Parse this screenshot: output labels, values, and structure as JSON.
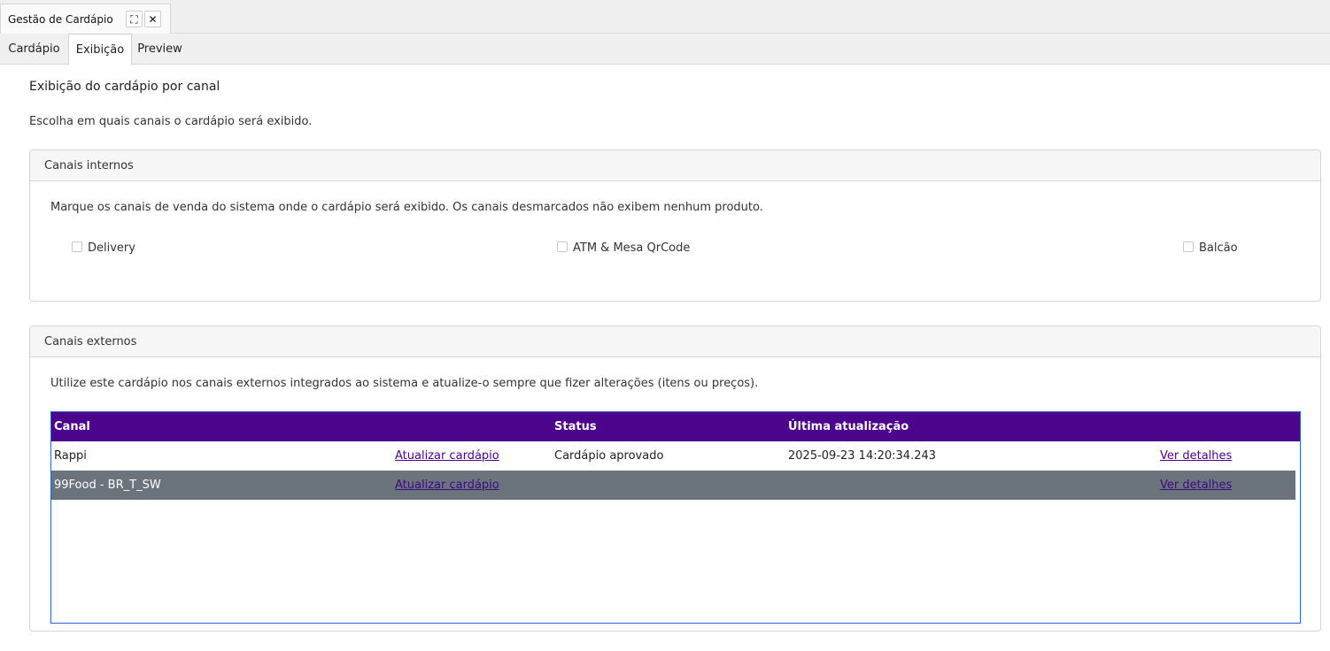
{
  "window_tab": {
    "title": "Gestão de Cardápio",
    "expand_glyph": "⛶",
    "close_glyph": "✕"
  },
  "subtabs": [
    {
      "label": "Cardápio",
      "active": false
    },
    {
      "label": "Exibição",
      "active": true
    },
    {
      "label": "Preview",
      "active": false
    }
  ],
  "page": {
    "title": "Exibição do cardápio por canal",
    "description": "Escolha em quais canais o cardápio será exibido."
  },
  "internal_channels": {
    "header": "Canais internos",
    "description": "Marque os canais de venda do sistema onde o cardápio será exibido. Os canais desmarcados não exibem nenhum produto.",
    "options": [
      {
        "label": "Delivery",
        "checked": false
      },
      {
        "label": "ATM & Mesa QrCode",
        "checked": false
      },
      {
        "label": "Balcão",
        "checked": false
      }
    ]
  },
  "external_channels": {
    "header": "Canais externos",
    "description": "Utilize este cardápio nos canais externos integrados ao sistema e atualize-o sempre que fizer alterações (itens ou preços).",
    "columns": {
      "canal": "Canal",
      "status": "Status",
      "last_update": "Última atualização"
    },
    "rows": [
      {
        "canal": "Rappi",
        "update_action": "Atualizar cardápio",
        "status": "Cardápio aprovado",
        "last_update": "2025-09-23 14:20:34.243",
        "details_action": "Ver detalhes",
        "selected": false
      },
      {
        "canal": "99Food - BR_T_SW",
        "update_action": "Atualizar cardápio",
        "status": "",
        "last_update": "",
        "details_action": "Ver detalhes",
        "selected": true
      }
    ]
  },
  "colors": {
    "table_header": "#4b048c",
    "selected_row": "#6b737d",
    "table_border": "#2b5fd9",
    "link": "#4b048c"
  }
}
